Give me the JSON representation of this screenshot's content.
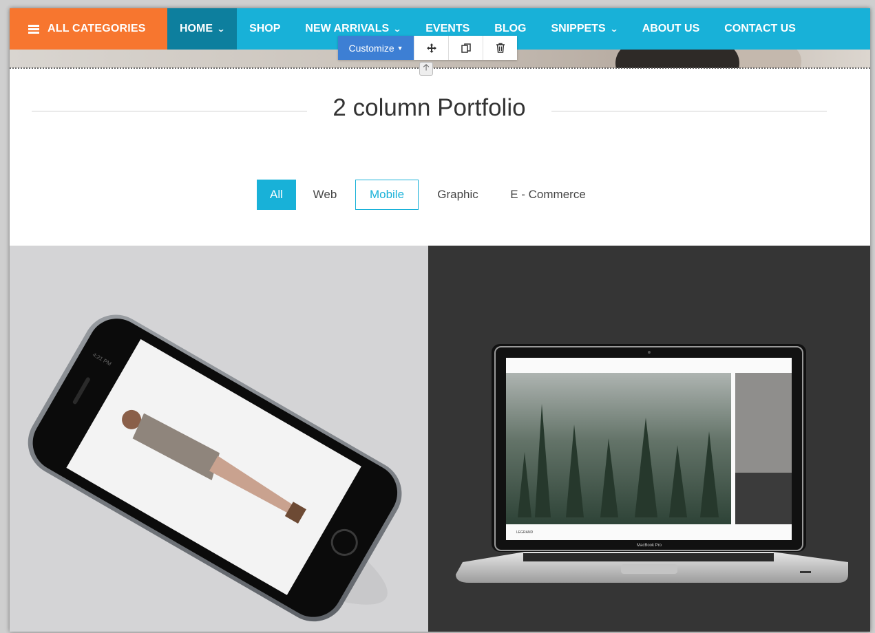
{
  "nav": {
    "categories_label": "ALL CATEGORIES",
    "items": [
      {
        "label": "HOME",
        "dropdown": true,
        "active": true
      },
      {
        "label": "SHOP",
        "dropdown": false
      },
      {
        "label": "NEW ARRIVALS",
        "dropdown": true
      },
      {
        "label": "EVENTS",
        "dropdown": false
      },
      {
        "label": "BLOG",
        "dropdown": false
      },
      {
        "label": "SNIPPETS",
        "dropdown": true
      },
      {
        "label": "ABOUT US",
        "dropdown": false
      },
      {
        "label": "CONTACT US",
        "dropdown": false
      }
    ]
  },
  "editor_toolbar": {
    "customize_label": "Customize",
    "icons": [
      "move-icon",
      "duplicate-icon",
      "trash-icon"
    ]
  },
  "section": {
    "title": "2 column Portfolio"
  },
  "filters": [
    {
      "label": "All",
      "state": "active"
    },
    {
      "label": "Web",
      "state": "normal"
    },
    {
      "label": "Mobile",
      "state": "outlined"
    },
    {
      "label": "Graphic",
      "state": "normal"
    },
    {
      "label": "E - Commerce",
      "state": "normal"
    }
  ],
  "portfolio": {
    "phone_status": "4:21 PM",
    "laptop_brand": "MacBook Pro",
    "laptop_site_label": "LEGRAND"
  },
  "colors": {
    "nav_bg": "#18b1d8",
    "nav_active": "#0d7f9e",
    "categories_bg": "#f7762f",
    "customize_btn": "#3d7fd4",
    "accent": "#18b1d8"
  }
}
